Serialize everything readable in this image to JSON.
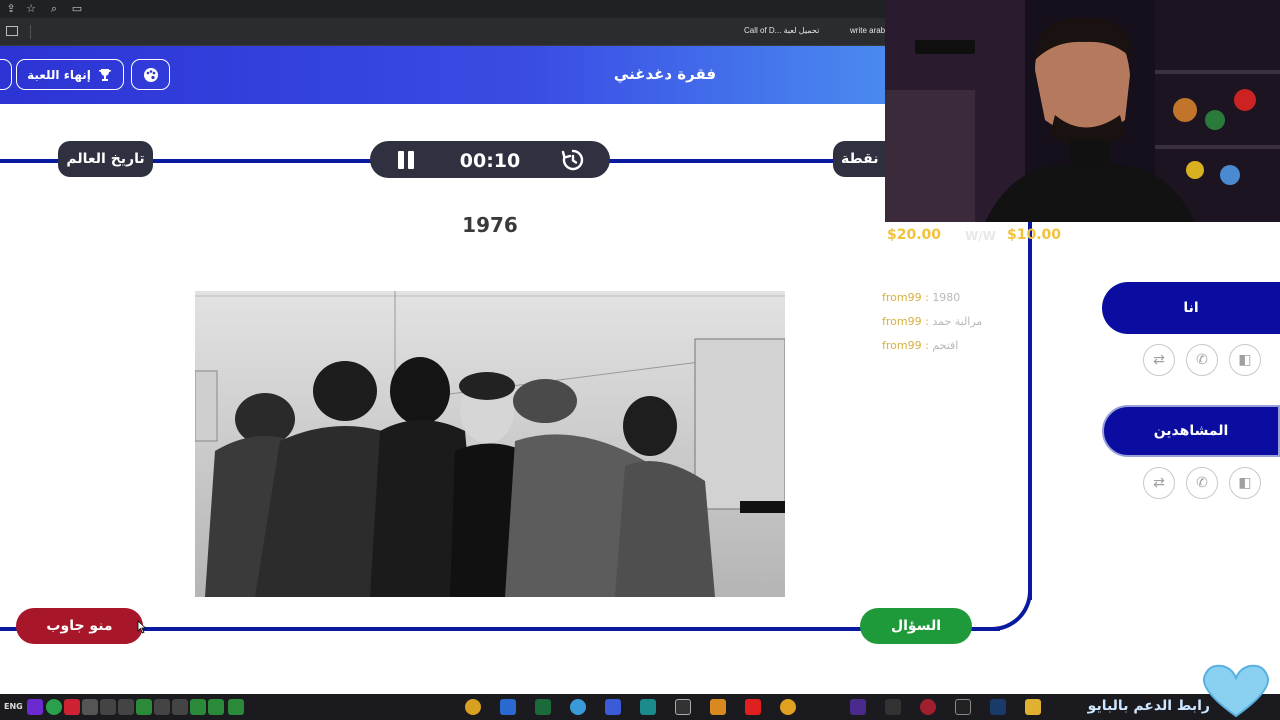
{
  "browser": {
    "tab1": "Call of D... تحميل لعبة",
    "tab2": "write arab"
  },
  "header": {
    "title": "فقرة دغدغني",
    "end_game": "إنهاء اللعبة"
  },
  "game": {
    "category": "تاريخ العالم",
    "points": "نقطة",
    "timer": "00:10",
    "year": "1976",
    "question_btn": "السؤال",
    "who_answered_btn": "منو جاوب"
  },
  "panel": {
    "money_left": "$20.00",
    "money_sep": "W/W",
    "money_right": "$10.00",
    "team1": "انا",
    "team2": "المشاهدين"
  },
  "chat": [
    {
      "user": "from99",
      "msg": "1980"
    },
    {
      "user": "from99",
      "msg": "مرالية حمد"
    },
    {
      "user": "from99",
      "msg": "اقتحم"
    }
  ],
  "taskbar": {
    "lang": "ENG",
    "overlay": "رابط الدعم بالبايو"
  },
  "colors": {
    "header_blue": "#2c34d4",
    "track_blue": "#0a1aa0",
    "dark_pill": "#2f3140",
    "green": "#1e9a3a",
    "red": "#a8162a",
    "team_blue": "#0a0da0",
    "money_gold": "#f2c23a"
  }
}
